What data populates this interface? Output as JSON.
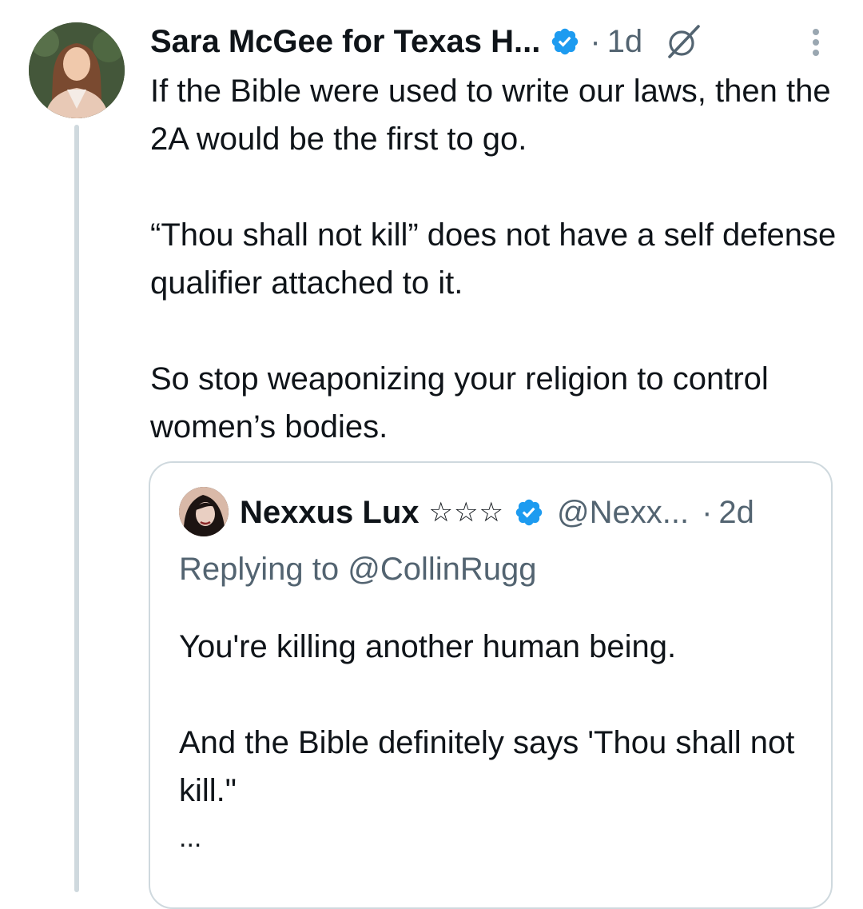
{
  "tweet": {
    "author_name": "Sara McGee for Texas H...",
    "separator": "·",
    "time": "1d",
    "paragraphs": [
      "If the Bible were used to write our laws, then the 2A would be the first to go.",
      "“Thou shall not kill” does not have a self defense qualifier attached to it.",
      "So stop weaponizing your religion to control women’s bodies."
    ]
  },
  "quote": {
    "author_name": "Nexxus Lux",
    "stars": "☆☆☆",
    "handle": "@Nexx...",
    "separator": "·",
    "time": "2d",
    "replying_to": "Replying to @CollinRugg",
    "paragraphs": [
      "You're killing another human being.",
      "And the Bible definitely says 'Thou shall not kill.\""
    ],
    "ellipsis": "..."
  },
  "icons": {
    "verified": "verified-badge-icon",
    "grok": "grok-icon",
    "more": "more-options-icon"
  },
  "colors": {
    "text_primary": "#0f1419",
    "text_secondary": "#536471",
    "verified_blue": "#1d9bf0",
    "border": "#cfd9de"
  }
}
